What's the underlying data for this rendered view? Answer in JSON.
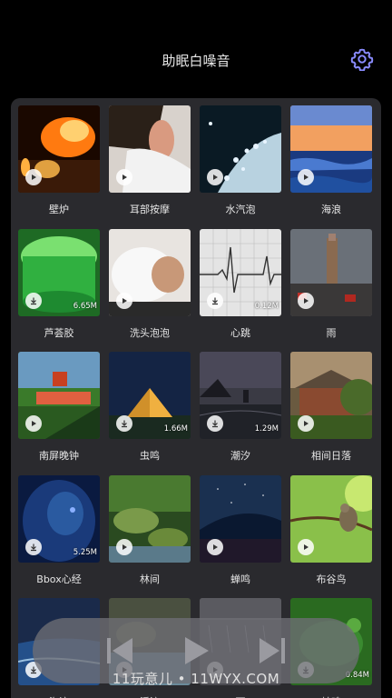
{
  "header": {
    "title": "助眠白噪音",
    "settings_icon": "gear-icon"
  },
  "items": [
    {
      "label": "壁炉",
      "state": "play",
      "size": ""
    },
    {
      "label": "耳部按摩",
      "state": "play",
      "size": ""
    },
    {
      "label": "水汽泡",
      "state": "play",
      "size": ""
    },
    {
      "label": "海浪",
      "state": "play",
      "size": ""
    },
    {
      "label": "芦荟胶",
      "state": "download",
      "size": "6.65M"
    },
    {
      "label": "洗头泡泡",
      "state": "play",
      "size": ""
    },
    {
      "label": "心跳",
      "state": "download",
      "size": "0.12M"
    },
    {
      "label": "雨",
      "state": "play",
      "size": ""
    },
    {
      "label": "南屏晚钟",
      "state": "play",
      "size": ""
    },
    {
      "label": "虫鸣",
      "state": "download",
      "size": "1.66M"
    },
    {
      "label": "潮汐",
      "state": "download",
      "size": "1.29M"
    },
    {
      "label": "相间日落",
      "state": "play",
      "size": ""
    },
    {
      "label": "Bbox心经",
      "state": "download",
      "size": "5.25M"
    },
    {
      "label": "林间",
      "state": "play",
      "size": ""
    },
    {
      "label": "蝉鸣",
      "state": "play",
      "size": ""
    },
    {
      "label": "布谷鸟",
      "state": "play",
      "size": ""
    },
    {
      "label": "海浪",
      "state": "download",
      "size": ""
    },
    {
      "label": "溪流",
      "state": "play",
      "size": ""
    },
    {
      "label": "雨",
      "state": "play",
      "size": ""
    },
    {
      "label": "蛙鸣",
      "state": "download",
      "size": "0.84M"
    }
  ],
  "player": {
    "prev_icon": "previous-icon",
    "play_icon": "play-icon",
    "next_icon": "next-icon"
  },
  "watermark": "11玩意儿 • 11WYX.COM",
  "colors": {
    "background": "#000000",
    "panel": "#2a2a2e",
    "accent_gear": "#8a8cff",
    "player_bar": "#6e6e74"
  }
}
